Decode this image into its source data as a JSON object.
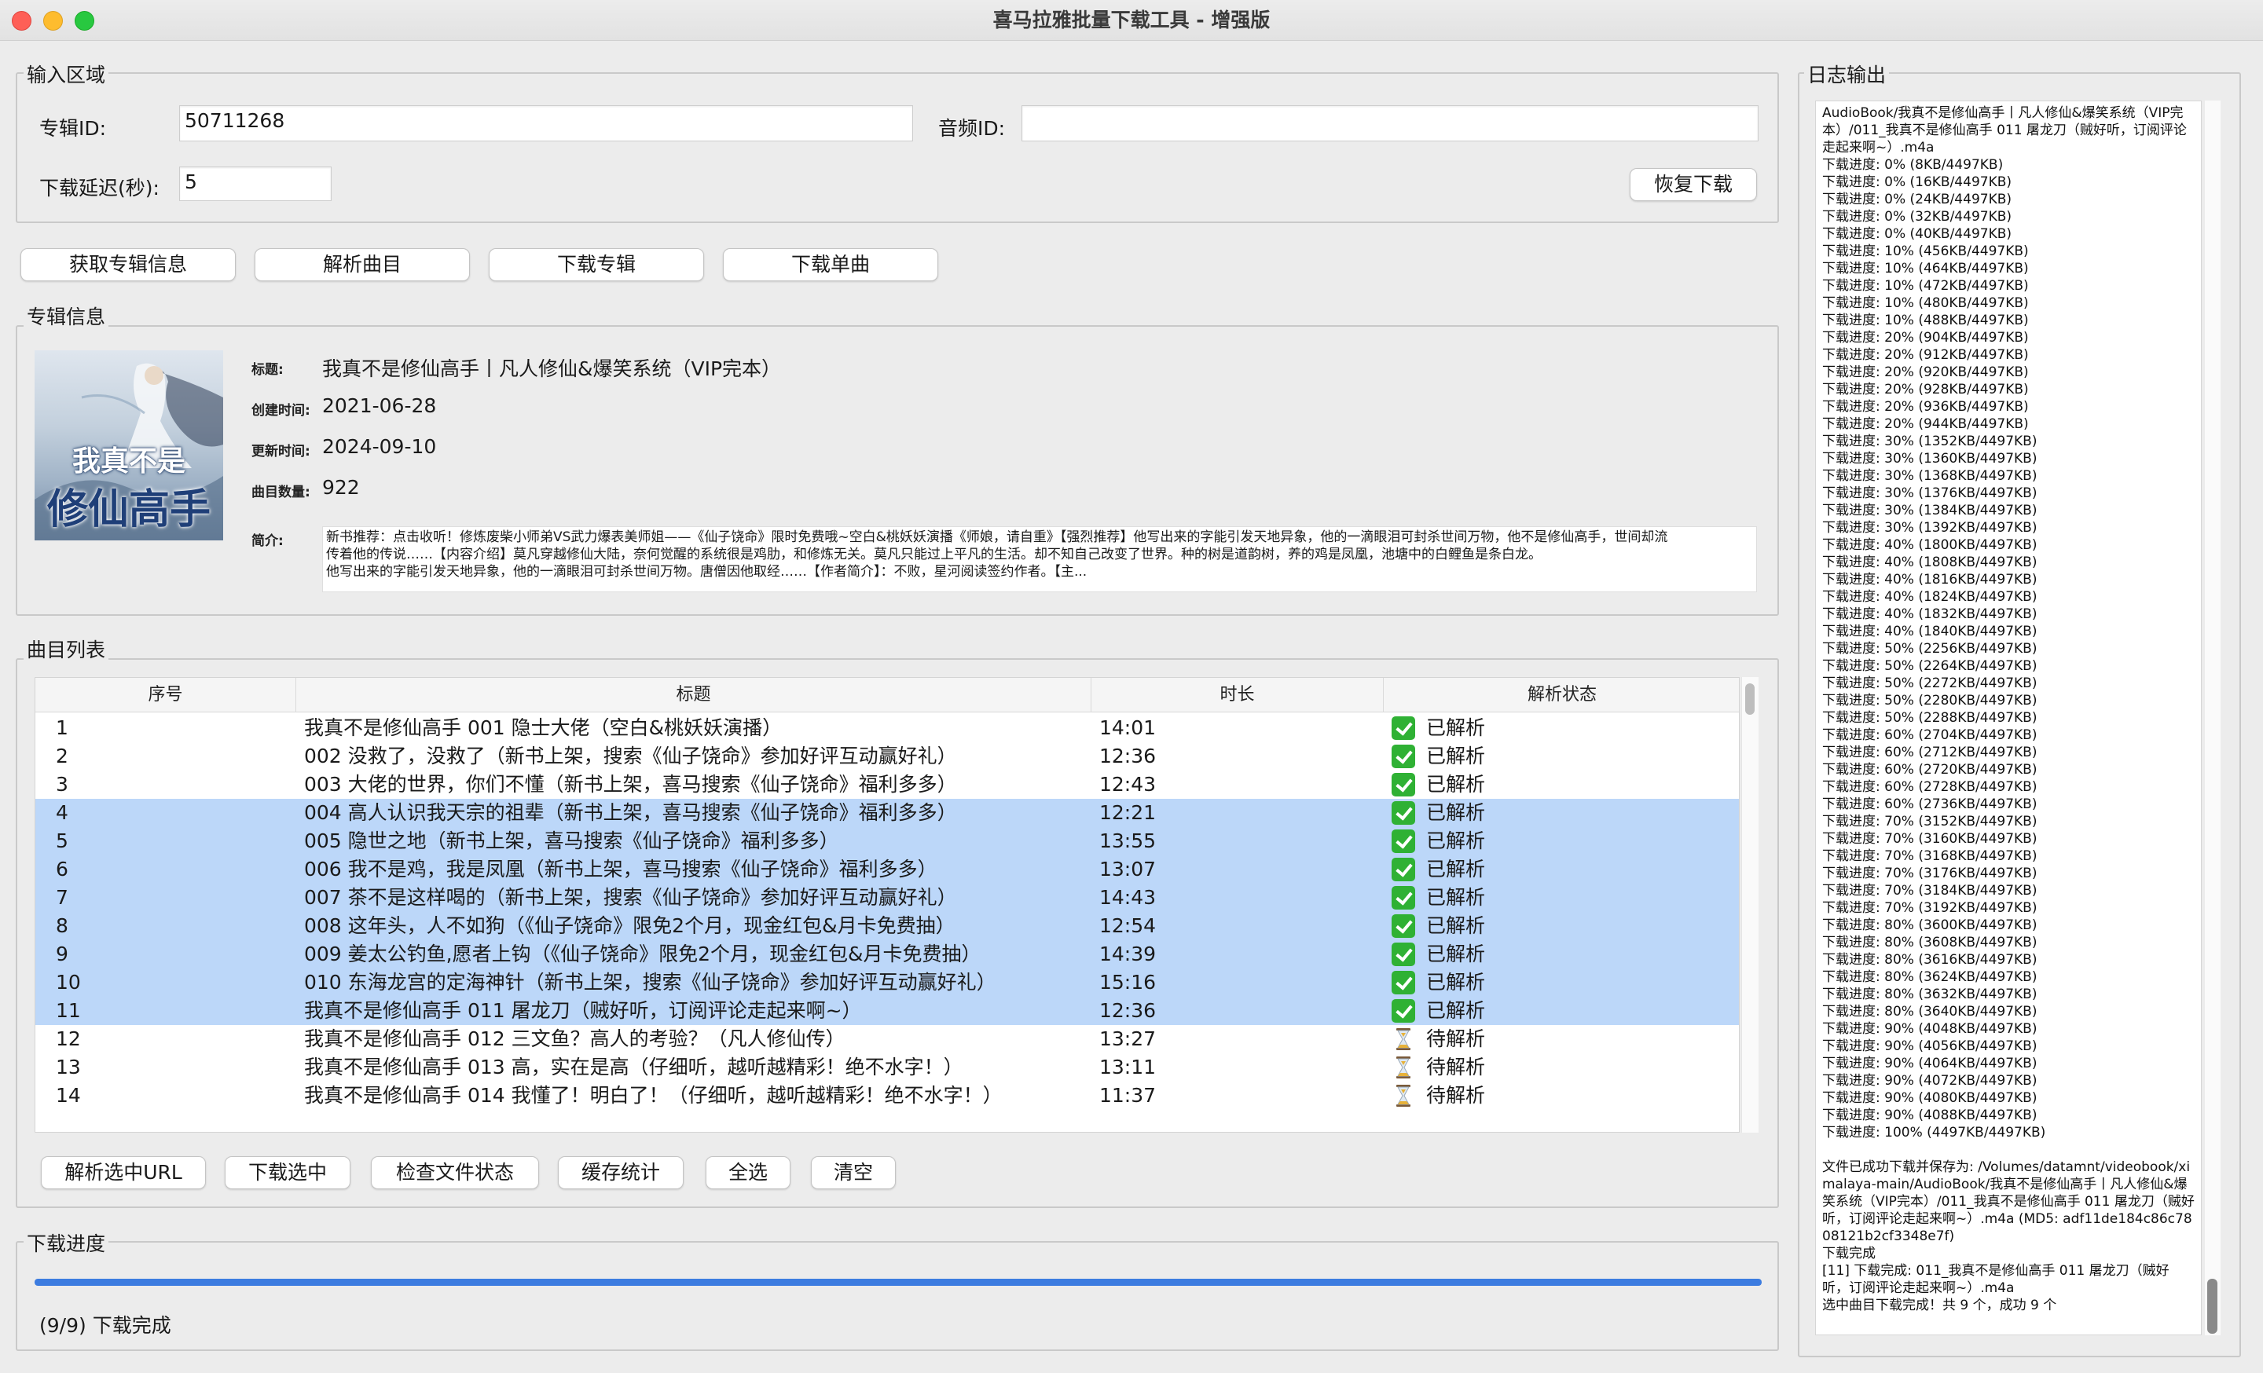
{
  "window": {
    "title": "喜马拉雅批量下载工具 - 增强版",
    "traffic_lights": {
      "close": "#fe5f57",
      "minimize": "#febc2e",
      "zoom": "#28c840"
    }
  },
  "input_area": {
    "label": "输入区域",
    "album_id_label": "专辑ID:",
    "album_id_value": "50711268",
    "audio_id_label": "音频ID:",
    "audio_id_value": "",
    "delay_label": "下载延迟(秒):",
    "delay_value": "5",
    "resume_button": "恢复下载"
  },
  "actions": {
    "fetch_album": "获取专辑信息",
    "parse_tracks": "解析曲目",
    "download_album": "下载专辑",
    "download_single": "下载单曲"
  },
  "album_info": {
    "label": "专辑信息",
    "cover_text_top": "我真不是",
    "cover_text_bottom": "修仙高手",
    "title_key": "标题:",
    "title_value": "我真不是修仙高手丨凡人修仙&爆笑系统（VIP完本）",
    "created_key": "创建时间:",
    "created_value": "2021-06-28",
    "updated_key": "更新时间:",
    "updated_value": "2024-09-10",
    "count_key": "曲目数量:",
    "count_value": "922",
    "intro_key": "简介:",
    "intro_lines": [
      "新书推荐：点击收听！修炼废柴小师弟VS武力爆表美师姐——《仙子饶命》限时免费哦~空白&桃妖妖演播《师娘，请自重》【强烈推荐】他写出来的字能引发天地异象，他的一滴眼泪可封杀世间万物，他不是修仙高手，世间却流",
      "传着他的传说……【内容介绍】莫凡穿越修仙大陆，奈何觉醒的系统很是鸡肋，和修炼无关。莫凡只能过上平凡的生活。却不知自己改变了世界。种的树是道韵树，养的鸡是凤凰，池塘中的白鲤鱼是条白龙。",
      "他写出来的字能引发天地异象，他的一滴眼泪可封杀世间万物。唐僧因他取经……【作者简介】：不败，星河阅读签约作者。【主..."
    ]
  },
  "track_list": {
    "label": "曲目列表",
    "columns": [
      "序号",
      "标题",
      "时长",
      "解析状态"
    ],
    "rows": [
      {
        "no": "1",
        "title": "我真不是修仙高手 001 隐士大佬（空白&桃妖妖演播）",
        "duration": "14:01",
        "status": "已解析",
        "icon": "check-icon",
        "selected": false
      },
      {
        "no": "2",
        "title": "002 没救了，没救了（新书上架，搜索《仙子饶命》参加好评互动赢好礼）",
        "duration": "12:36",
        "status": "已解析",
        "icon": "check-icon",
        "selected": false
      },
      {
        "no": "3",
        "title": "003 大佬的世界，你们不懂（新书上架，喜马搜索《仙子饶命》福利多多）",
        "duration": "12:43",
        "status": "已解析",
        "icon": "check-icon",
        "selected": false
      },
      {
        "no": "4",
        "title": "004 高人认识我天宗的祖辈（新书上架，喜马搜索《仙子饶命》福利多多）",
        "duration": "12:21",
        "status": "已解析",
        "icon": "check-icon",
        "selected": true
      },
      {
        "no": "5",
        "title": "005 隐世之地（新书上架，喜马搜索《仙子饶命》福利多多）",
        "duration": "13:55",
        "status": "已解析",
        "icon": "check-icon",
        "selected": true
      },
      {
        "no": "6",
        "title": "006 我不是鸡，我是凤凰（新书上架，喜马搜索《仙子饶命》福利多多）",
        "duration": "13:07",
        "status": "已解析",
        "icon": "check-icon",
        "selected": true
      },
      {
        "no": "7",
        "title": "007 茶不是这样喝的（新书上架，搜索《仙子饶命》参加好评互动赢好礼）",
        "duration": "14:43",
        "status": "已解析",
        "icon": "check-icon",
        "selected": true
      },
      {
        "no": "8",
        "title": "008 这年头，人不如狗（《仙子饶命》限免2个月，现金红包&月卡免费抽）",
        "duration": "12:54",
        "status": "已解析",
        "icon": "check-icon",
        "selected": true
      },
      {
        "no": "9",
        "title": "009 姜太公钓鱼,愿者上钩（《仙子饶命》限免2个月，现金红包&月卡免费抽）",
        "duration": "14:39",
        "status": "已解析",
        "icon": "check-icon",
        "selected": true
      },
      {
        "no": "10",
        "title": "010 东海龙宫的定海神针（新书上架，搜索《仙子饶命》参加好评互动赢好礼）",
        "duration": "15:16",
        "status": "已解析",
        "icon": "check-icon",
        "selected": true
      },
      {
        "no": "11",
        "title": "我真不是修仙高手 011 屠龙刀（贼好听，订阅评论走起来啊~）",
        "duration": "12:36",
        "status": "已解析",
        "icon": "check-icon",
        "selected": true
      },
      {
        "no": "12",
        "title": "我真不是修仙高手 012 三文鱼？高人的考验？（凡人修仙传）",
        "duration": "13:27",
        "status": "待解析",
        "icon": "hourglass-icon",
        "selected": false
      },
      {
        "no": "13",
        "title": "我真不是修仙高手 013 高，实在是高（仔细听，越听越精彩！绝不水字！）",
        "duration": "13:11",
        "status": "待解析",
        "icon": "hourglass-icon",
        "selected": false
      },
      {
        "no": "14",
        "title": "我真不是修仙高手 014 我懂了！明白了！（仔细听，越听越精彩！绝不水字！）",
        "duration": "11:37",
        "status": "待解析",
        "icon": "hourglass-icon",
        "selected": false
      }
    ],
    "buttons": {
      "parse_selected_url": "解析选中URL",
      "download_selected": "下载选中",
      "check_file_status": "检查文件状态",
      "cache_stats": "缓存统计",
      "select_all": "全选",
      "clear": "清空"
    }
  },
  "download_progress": {
    "label": "下载进度",
    "fraction": 1.0,
    "status_text": "(9/9) 下载完成",
    "bar_color": "#3c7ce0"
  },
  "log": {
    "label": "日志输出",
    "lines": [
      "AudioBook/我真不是修仙高手丨凡人修仙&爆笑系统（VIP完本）/011_我真不是修仙高手 011 屠龙刀（贼好听，订阅评论走起来啊~）.m4a",
      "下载进度: 0% (8KB/4497KB)",
      "下载进度: 0% (16KB/4497KB)",
      "下载进度: 0% (24KB/4497KB)",
      "下载进度: 0% (32KB/4497KB)",
      "下载进度: 0% (40KB/4497KB)",
      "下载进度: 10% (456KB/4497KB)",
      "下载进度: 10% (464KB/4497KB)",
      "下载进度: 10% (472KB/4497KB)",
      "下载进度: 10% (480KB/4497KB)",
      "下载进度: 10% (488KB/4497KB)",
      "下载进度: 20% (904KB/4497KB)",
      "下载进度: 20% (912KB/4497KB)",
      "下载进度: 20% (920KB/4497KB)",
      "下载进度: 20% (928KB/4497KB)",
      "下载进度: 20% (936KB/4497KB)",
      "下载进度: 20% (944KB/4497KB)",
      "下载进度: 30% (1352KB/4497KB)",
      "下载进度: 30% (1360KB/4497KB)",
      "下载进度: 30% (1368KB/4497KB)",
      "下载进度: 30% (1376KB/4497KB)",
      "下载进度: 30% (1384KB/4497KB)",
      "下载进度: 30% (1392KB/4497KB)",
      "下载进度: 40% (1800KB/4497KB)",
      "下载进度: 40% (1808KB/4497KB)",
      "下载进度: 40% (1816KB/4497KB)",
      "下载进度: 40% (1824KB/4497KB)",
      "下载进度: 40% (1832KB/4497KB)",
      "下载进度: 40% (1840KB/4497KB)",
      "下载进度: 50% (2256KB/4497KB)",
      "下载进度: 50% (2264KB/4497KB)",
      "下载进度: 50% (2272KB/4497KB)",
      "下载进度: 50% (2280KB/4497KB)",
      "下载进度: 50% (2288KB/4497KB)",
      "下载进度: 60% (2704KB/4497KB)",
      "下载进度: 60% (2712KB/4497KB)",
      "下载进度: 60% (2720KB/4497KB)",
      "下载进度: 60% (2728KB/4497KB)",
      "下载进度: 60% (2736KB/4497KB)",
      "下载进度: 70% (3152KB/4497KB)",
      "下载进度: 70% (3160KB/4497KB)",
      "下载进度: 70% (3168KB/4497KB)",
      "下载进度: 70% (3176KB/4497KB)",
      "下载进度: 70% (3184KB/4497KB)",
      "下载进度: 70% (3192KB/4497KB)",
      "下载进度: 80% (3600KB/4497KB)",
      "下载进度: 80% (3608KB/4497KB)",
      "下载进度: 80% (3616KB/4497KB)",
      "下载进度: 80% (3624KB/4497KB)",
      "下载进度: 80% (3632KB/4497KB)",
      "下载进度: 80% (3640KB/4497KB)",
      "下载进度: 90% (4048KB/4497KB)",
      "下载进度: 90% (4056KB/4497KB)",
      "下载进度: 90% (4064KB/4497KB)",
      "下载进度: 90% (4072KB/4497KB)",
      "下载进度: 90% (4080KB/4497KB)",
      "下载进度: 90% (4088KB/4497KB)",
      "下载进度: 100% (4497KB/4497KB)",
      "",
      "文件已成功下载并保存为: /Volumes/datamnt/videobook/ximalaya-main/AudioBook/我真不是修仙高手丨凡人修仙&爆笑系统（VIP完本）/011_我真不是修仙高手 011 屠龙刀（贼好听，订阅评论走起来啊~）.m4a (MD5: adf11de184c86c7808121b2cf3348e7f)",
      "下载完成",
      "[11] 下载完成: 011_我真不是修仙高手 011 屠龙刀（贼好听，订阅评论走起来啊~）.m4a",
      "选中曲目下载完成！共 9 个，成功 9 个"
    ]
  }
}
